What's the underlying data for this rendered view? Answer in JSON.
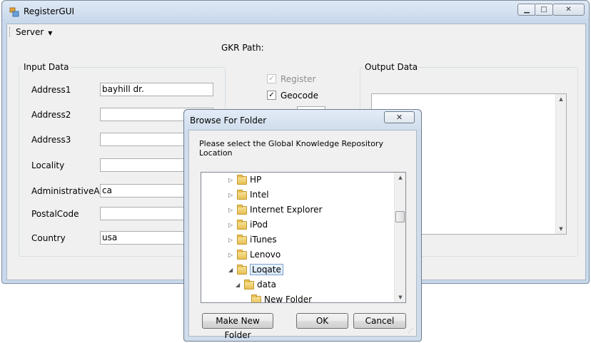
{
  "window": {
    "title": "RegisterGUI"
  },
  "menu": {
    "server": "Server"
  },
  "gkr": {
    "label": "GKR Path:"
  },
  "input_group": {
    "title": "Input Data",
    "fields": [
      {
        "label": "Address1",
        "value": "bayhill dr."
      },
      {
        "label": "Address2",
        "value": ""
      },
      {
        "label": "Address3",
        "value": ""
      },
      {
        "label": "Locality",
        "value": ""
      },
      {
        "label": "AdministrativeArea",
        "value": "ca"
      },
      {
        "label": "PostalCode",
        "value": ""
      },
      {
        "label": "Country",
        "value": "usa"
      }
    ]
  },
  "options": {
    "register": {
      "label": "Register",
      "checked": true,
      "enabled": false
    },
    "geocode": {
      "label": "Geocode",
      "checked": true,
      "enabled": true
    }
  },
  "output_group": {
    "title": "Output Data",
    "text": ""
  },
  "dialog": {
    "title": "Browse For Folder",
    "instruction": "Please select the Global Knowledge Repository Location",
    "tree": [
      {
        "label": "HP"
      },
      {
        "label": "Intel"
      },
      {
        "label": "Internet Explorer"
      },
      {
        "label": "iPod"
      },
      {
        "label": "iTunes"
      },
      {
        "label": "Lenovo"
      },
      {
        "label": "Loqate"
      },
      {
        "label": "data"
      },
      {
        "label": "New Folder"
      }
    ],
    "buttons": {
      "make_new_folder": "Make New Folder",
      "ok": "OK",
      "cancel": "Cancel"
    }
  }
}
